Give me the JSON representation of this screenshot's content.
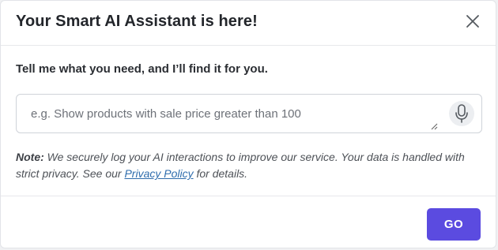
{
  "dialog": {
    "title": "Your Smart AI Assistant is here!",
    "close_icon": "close-icon"
  },
  "query": {
    "prompt": "Tell me what you need, and I’ll find it for you.",
    "placeholder": "e.g. Show products with sale price greater than 100",
    "value": "",
    "mic_icon": "microphone-icon"
  },
  "note": {
    "label": "Note:",
    "text_before_link": " We securely log your AI interactions to improve our service. Your data is handled with strict privacy. See our ",
    "link_text": "Privacy Policy",
    "text_after_link": " for details."
  },
  "footer": {
    "go_label": "GO"
  },
  "colors": {
    "accent": "#5b4be0",
    "link": "#2f6dad"
  }
}
